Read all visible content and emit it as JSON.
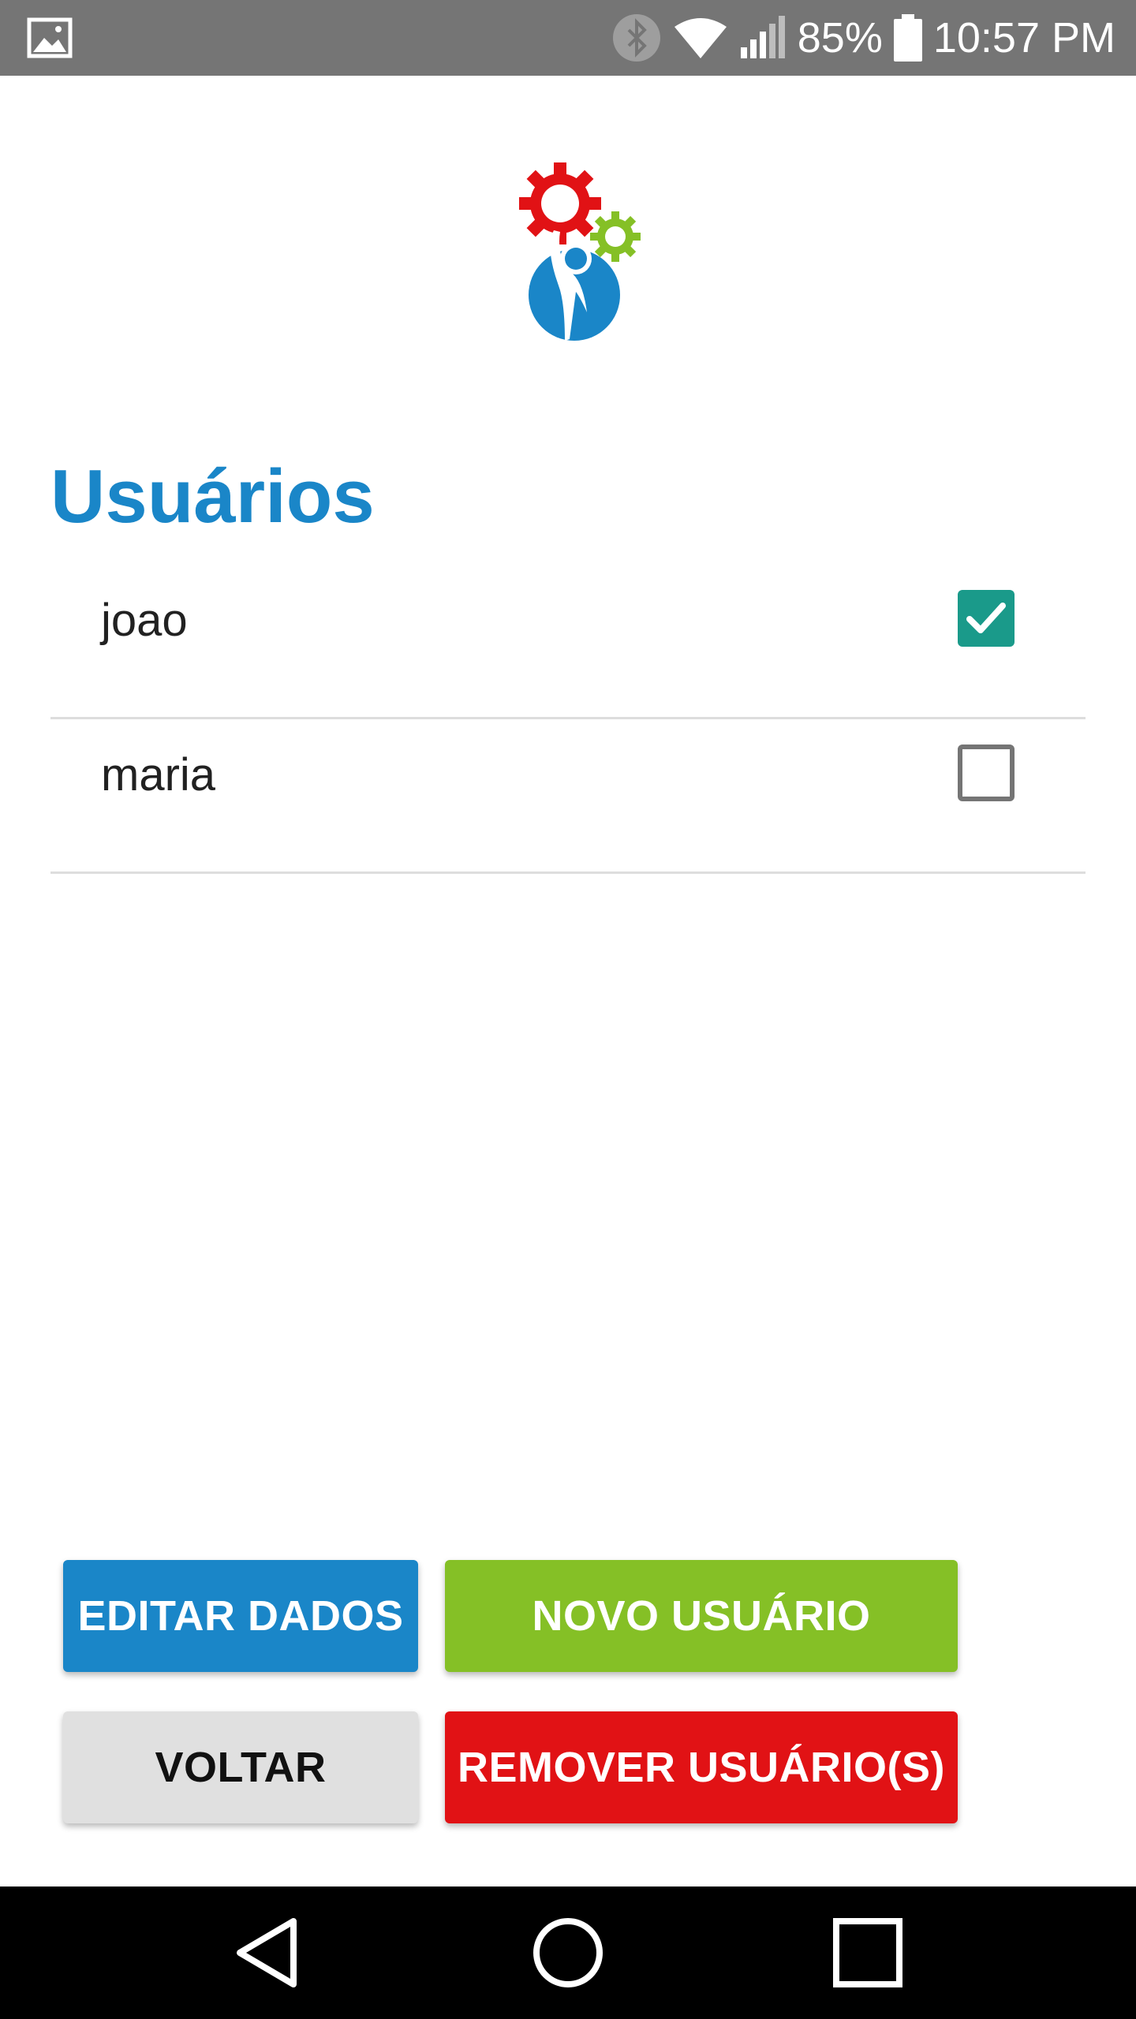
{
  "status_bar": {
    "battery_text": "85%",
    "time": "10:57 PM",
    "icons": [
      "gallery-icon",
      "bluetooth-icon",
      "wifi-icon",
      "signal-icon",
      "battery-icon"
    ]
  },
  "logo": {
    "icon": "gears-person-logo",
    "colors": {
      "gear_large": "#e11215",
      "gear_small": "#85c026",
      "person": "#1a86c8"
    }
  },
  "page": {
    "title": "Usuários"
  },
  "users": [
    {
      "name": "joao",
      "checked": true
    },
    {
      "name": "maria",
      "checked": false
    }
  ],
  "buttons": {
    "edit": "EDITAR DADOS",
    "new_user": "NOVO USUÁRIO",
    "back": "VOLTAR",
    "remove": "REMOVER USUÁRIO(S)"
  },
  "colors": {
    "accent_blue": "#1a86c8",
    "accent_green": "#85c026",
    "accent_red": "#e11215",
    "checkbox_teal": "#1a9a8a"
  },
  "nav_bar": {
    "icons": [
      "back-triangle-icon",
      "home-circle-icon",
      "recents-square-icon"
    ]
  }
}
